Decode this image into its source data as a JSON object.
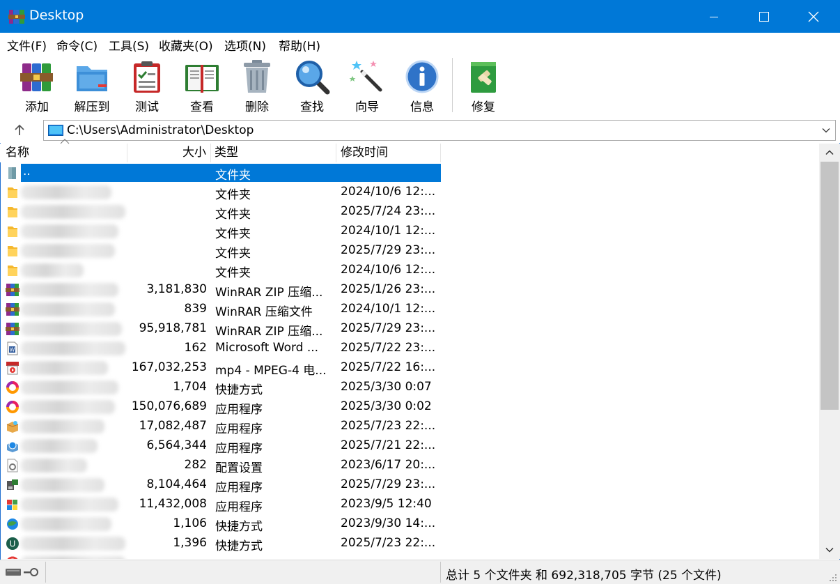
{
  "window": {
    "title": "Desktop",
    "accent_color": "#0078d7",
    "controls": [
      "minimize-icon",
      "maximize-icon",
      "close-icon"
    ]
  },
  "menu": [
    "文件(F)",
    "命令(C)",
    "工具(S)",
    "收藏夹(O)",
    "选项(N)",
    "帮助(H)"
  ],
  "toolbar": [
    {
      "label": "添加",
      "icon": "add-archive-icon"
    },
    {
      "label": "解压到",
      "icon": "extract-folder-icon"
    },
    {
      "label": "测试",
      "icon": "test-clipboard-icon"
    },
    {
      "label": "查看",
      "icon": "view-book-icon"
    },
    {
      "label": "删除",
      "icon": "trash-can-icon"
    },
    {
      "label": "查找",
      "icon": "magnifier-icon"
    },
    {
      "label": "向导",
      "icon": "wizard-wand-icon"
    },
    {
      "label": "信息",
      "icon": "info-icon"
    },
    {
      "label": "修复",
      "icon": "repair-kit-icon"
    }
  ],
  "address": {
    "path": "C:\\Users\\Administrator\\Desktop",
    "up_icon": "up-arrow-icon"
  },
  "columns": {
    "name": "名称",
    "size": "大小",
    "type": "类型",
    "modified": "修改时间",
    "sort": "name-ascending"
  },
  "files": [
    {
      "name": "..",
      "size": "",
      "type": "文件夹",
      "modified": "",
      "icon": "parent-folder-icon",
      "selected": true
    },
    {
      "name": "",
      "size": "",
      "type": "文件夹",
      "modified": "2024/10/6 12:...",
      "icon": "folder-icon"
    },
    {
      "name": "",
      "size": "",
      "type": "文件夹",
      "modified": "2025/7/24 23:...",
      "icon": "folder-icon"
    },
    {
      "name": "",
      "size": "",
      "type": "文件夹",
      "modified": "2024/10/1 12:...",
      "icon": "folder-icon"
    },
    {
      "name": "",
      "size": "",
      "type": "文件夹",
      "modified": "2025/7/29 23:...",
      "icon": "folder-icon"
    },
    {
      "name": "",
      "size": "",
      "type": "文件夹",
      "modified": "2024/10/6 12:...",
      "icon": "folder-icon"
    },
    {
      "name": "",
      "size": "3,181,830",
      "type": "WinRAR ZIP 压缩...",
      "modified": "2025/1/26 23:...",
      "icon": "winrar-archive-icon"
    },
    {
      "name": "",
      "size": "839",
      "type": "WinRAR 压缩文件",
      "modified": "2024/10/1 12:...",
      "icon": "winrar-archive-icon"
    },
    {
      "name": "",
      "size": "95,918,781",
      "type": "WinRAR ZIP 压缩...",
      "modified": "2025/7/29 23:...",
      "icon": "winrar-archive-icon"
    },
    {
      "name": "",
      "size": "162",
      "type": "Microsoft Word ...",
      "modified": "2025/7/22 23:...",
      "icon": "word-document-icon"
    },
    {
      "name": "",
      "size": "167,032,253",
      "type": "mp4 - MPEG-4 电...",
      "modified": "2025/7/22 16:...",
      "icon": "mp4-video-icon"
    },
    {
      "name": "",
      "size": "1,704",
      "type": "快捷方式",
      "modified": "2025/3/30 0:07",
      "icon": "colorful-ring-shortcut-icon"
    },
    {
      "name": "",
      "size": "150,076,689",
      "type": "应用程序",
      "modified": "2025/3/30 0:02",
      "icon": "colorful-ring-app-icon"
    },
    {
      "name": "",
      "size": "17,082,487",
      "type": "应用程序",
      "modified": "2025/7/23 22:...",
      "icon": "installer-box-icon"
    },
    {
      "name": "",
      "size": "6,564,344",
      "type": "应用程序",
      "modified": "2025/7/21 22:...",
      "icon": "installer-globe-icon"
    },
    {
      "name": "",
      "size": "282",
      "type": "配置设置",
      "modified": "2023/6/17 20:...",
      "icon": "config-settings-icon"
    },
    {
      "name": "",
      "size": "8,104,464",
      "type": "应用程序",
      "modified": "2025/7/29 23:...",
      "icon": "setup-app-icon"
    },
    {
      "name": "",
      "size": "11,432,008",
      "type": "应用程序",
      "modified": "2023/9/5 12:40",
      "icon": "windows-setup-icon"
    },
    {
      "name": "",
      "size": "1,106",
      "type": "快捷方式",
      "modified": "2023/9/30 14:...",
      "icon": "globe-shortcut-icon"
    },
    {
      "name": "",
      "size": "1,396",
      "type": "快捷方式",
      "modified": "2025/7/23 22:...",
      "icon": "u-logo-shortcut-icon"
    },
    {
      "name": "",
      "size": "",
      "type": "快捷方式",
      "modified": "",
      "icon": "red-shortcut-icon"
    }
  ],
  "status": {
    "text": "总计 5 个文件夹 和 692,318,705 字节 (25 个文件)",
    "icon": "drive-key-icon"
  }
}
